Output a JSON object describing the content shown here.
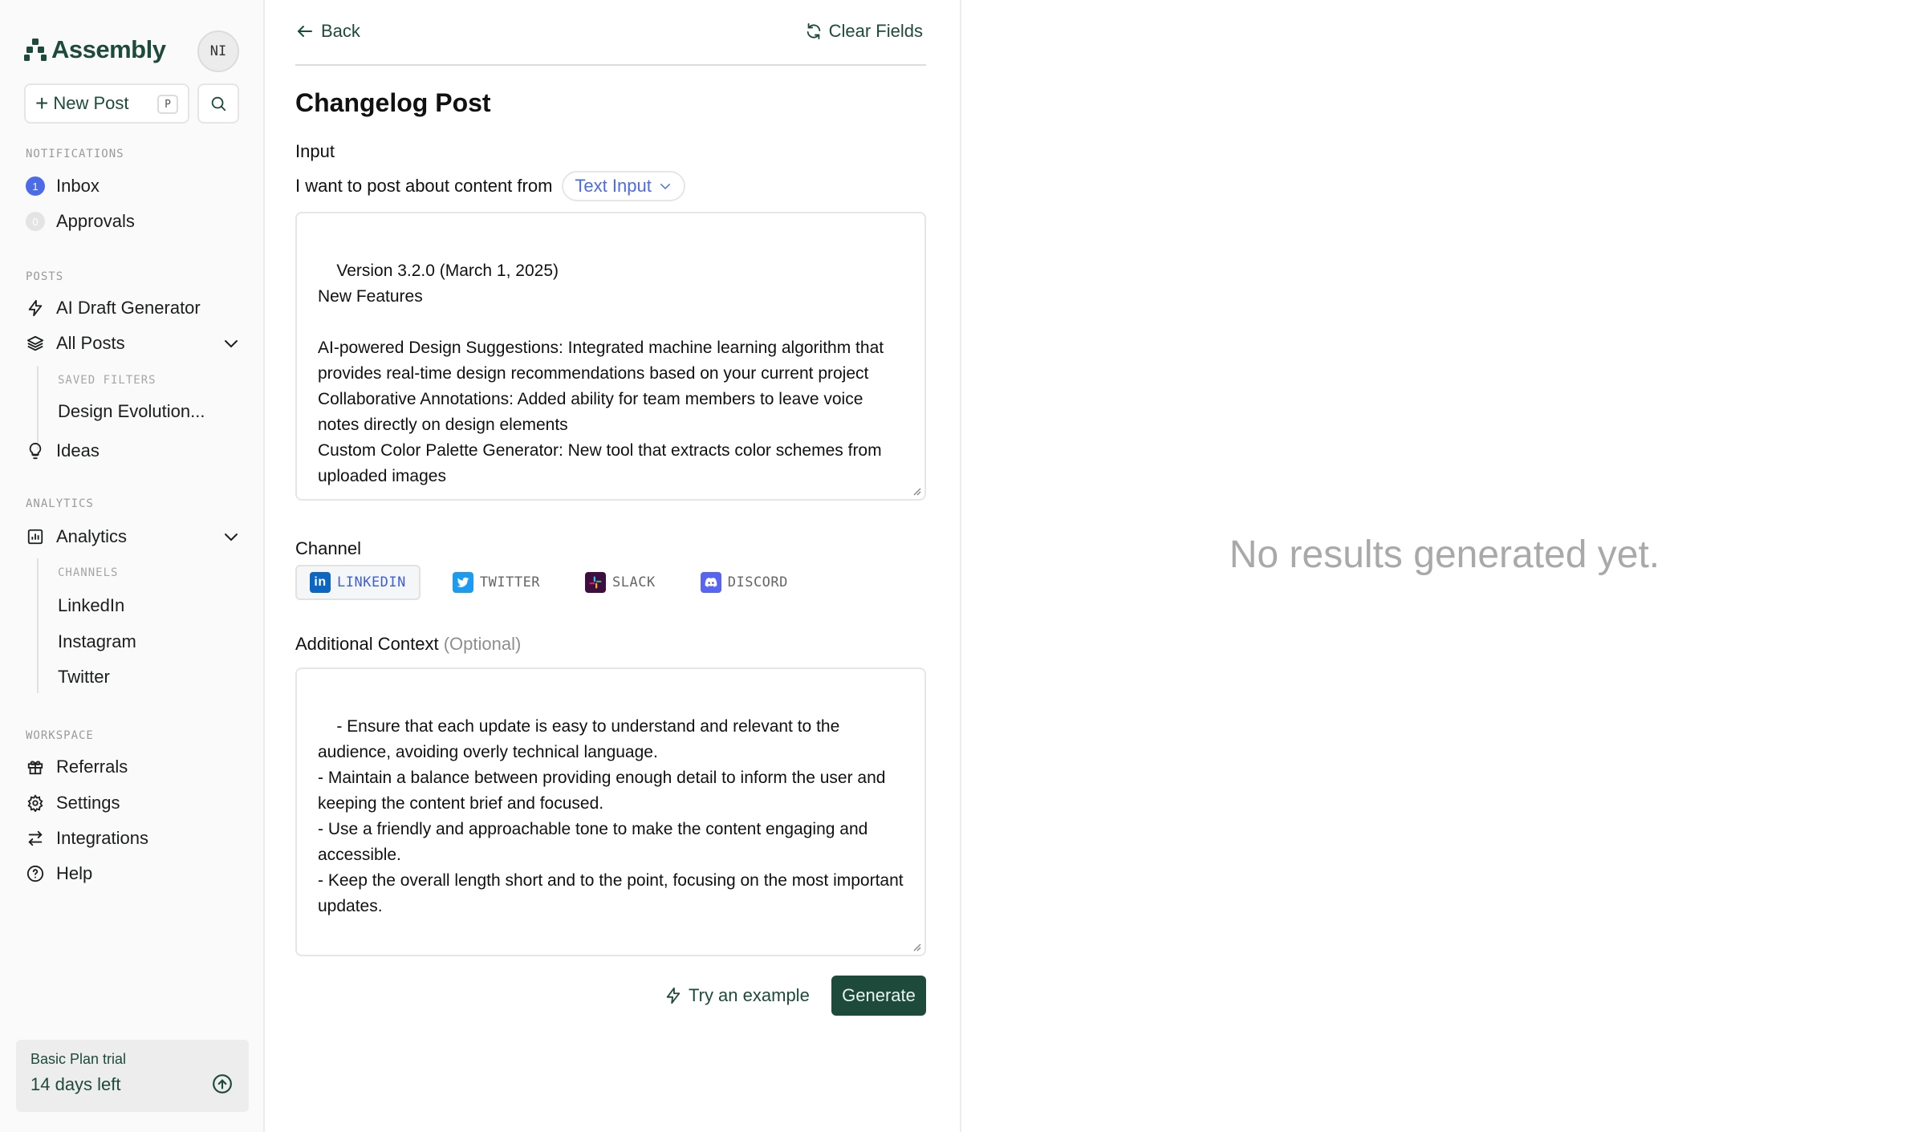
{
  "app": {
    "name": "Assembly"
  },
  "user": {
    "initials": "NI"
  },
  "toolbar": {
    "new_post": "New Post",
    "new_post_shortcut": "P"
  },
  "sidebar": {
    "notifications_label": "NOTIFICATIONS",
    "inbox": {
      "label": "Inbox",
      "count": "1"
    },
    "approvals": {
      "label": "Approvals",
      "count": "0"
    },
    "posts_label": "POSTS",
    "ai_draft": "AI Draft Generator",
    "all_posts": "All Posts",
    "saved_filters_label": "SAVED FILTERS",
    "saved_filter_1": "Design Evolution...",
    "ideas": "Ideas",
    "analytics_label": "ANALYTICS",
    "analytics": "Analytics",
    "channels_label": "CHANNELS",
    "channel_linkedin": "LinkedIn",
    "channel_instagram": "Instagram",
    "channel_twitter": "Twitter",
    "workspace_label": "WORKSPACE",
    "referrals": "Referrals",
    "settings": "Settings",
    "integrations": "Integrations",
    "help": "Help"
  },
  "trial": {
    "plan": "Basic Plan trial",
    "remaining": "14 days left"
  },
  "form": {
    "back": "Back",
    "clear": "Clear Fields",
    "title": "Changelog Post",
    "input_label": "Input",
    "source_prefix": "I want to post about content from",
    "source_value": "Text Input",
    "input_text": "Version 3.2.0 (March 1, 2025)\nNew Features\n\nAI-powered Design Suggestions: Integrated machine learning algorithm that provides real-time design recommendations based on your current project\nCollaborative Annotations: Added ability for team members to leave voice notes directly on design elements\nCustom Color Palette Generator: New tool that extracts color schemes from uploaded images",
    "channel_label": "Channel",
    "channels": {
      "linkedin": "LINKEDIN",
      "twitter": "TWITTER",
      "slack": "SLACK",
      "discord": "DISCORD"
    },
    "context_label": "Additional Context",
    "context_optional": "(Optional)",
    "context_text": "- Ensure that each update is easy to understand and relevant to the audience, avoiding overly technical language.\n- Maintain a balance between providing enough detail to inform the user and keeping the content brief and focused.\n- Use a friendly and approachable tone to make the content engaging and accessible.\n- Keep the overall length short and to the point, focusing on the most important updates.",
    "try_example": "Try an example",
    "generate": "Generate"
  },
  "results": {
    "empty": "No results generated yet."
  },
  "colors": {
    "brand": "#1d4a3b",
    "accent": "#4c6be8"
  }
}
